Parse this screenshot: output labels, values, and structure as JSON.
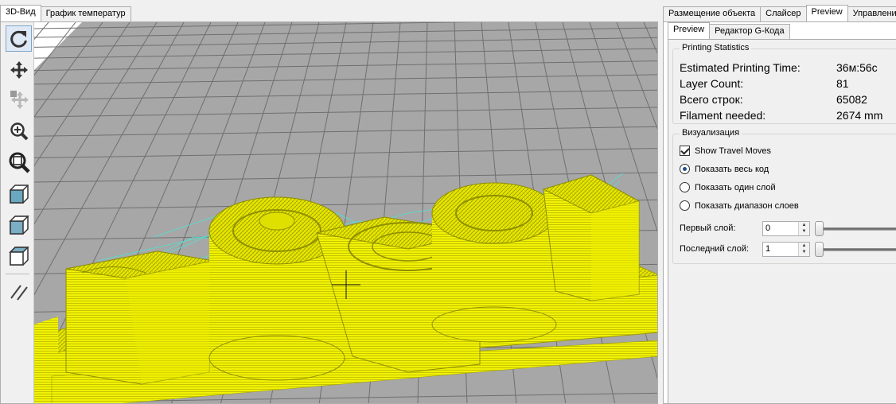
{
  "left_tabs": [
    {
      "label": "3D-Вид",
      "active": true
    },
    {
      "label": "График температур",
      "active": false
    }
  ],
  "right_tabs": [
    {
      "label": "Размещение объекта",
      "active": false
    },
    {
      "label": "Слайсер",
      "active": false
    },
    {
      "label": "Preview",
      "active": true
    },
    {
      "label": "Управление",
      "active": false
    }
  ],
  "sub_tabs": [
    {
      "label": "Preview",
      "active": true
    },
    {
      "label": "Редактор G-Кода",
      "active": false
    }
  ],
  "toolbar": {
    "tools": [
      {
        "icon": "rotate-icon",
        "selected": true
      },
      {
        "icon": "move-icon",
        "selected": false
      },
      {
        "icon": "move-object-icon",
        "selected": false
      },
      {
        "icon": "zoom-icon",
        "selected": false
      },
      {
        "icon": "zoom-fit-icon",
        "selected": false
      },
      {
        "icon": "view-iso-icon",
        "selected": false
      },
      {
        "icon": "view-front-icon",
        "selected": false
      },
      {
        "icon": "view-top-icon",
        "selected": false
      },
      {
        "icon": "parallel-projection-icon",
        "selected": false
      }
    ]
  },
  "stats": {
    "title": "Printing Statistics",
    "rows": [
      {
        "label": "Estimated Printing Time:",
        "value": "36м:56с"
      },
      {
        "label": "Layer Count:",
        "value": "81"
      },
      {
        "label": "Всего строк:",
        "value": "65082"
      },
      {
        "label": "Filament needed:",
        "value": "2674 mm"
      }
    ]
  },
  "visualization": {
    "title": "Визуализация",
    "show_travel_label": "Show Travel Moves",
    "show_travel_checked": true,
    "radio_options": [
      {
        "label": "Показать весь код",
        "selected": true
      },
      {
        "label": "Показать один слой",
        "selected": false
      },
      {
        "label": "Показать диапазон слоев",
        "selected": false
      }
    ],
    "first_layer_label": "Первый слой:",
    "first_layer_value": "0",
    "first_layer_slider": 0,
    "last_layer_label": "Последний слой:",
    "last_layer_value": "1",
    "last_layer_slider": 0
  },
  "colors": {
    "model": "#f2f205",
    "travel": "#4ee3d0",
    "bed_grid": "#6f6f6f",
    "background": "#ffffff"
  }
}
